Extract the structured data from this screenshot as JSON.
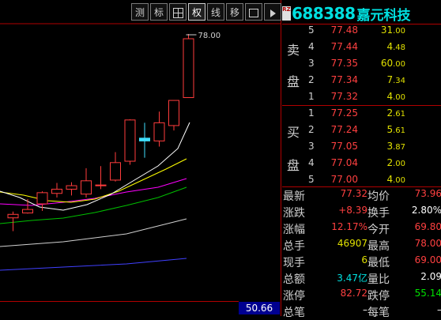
{
  "toolbar": {
    "buttons": [
      {
        "label": "测",
        "icon": null
      },
      {
        "label": "标",
        "icon": null
      },
      {
        "label": "",
        "icon": "grid-icon"
      },
      {
        "label": "权",
        "icon": null
      },
      {
        "label": "线",
        "icon": null
      },
      {
        "label": "移",
        "icon": null
      },
      {
        "label": "",
        "icon": "window-icon"
      },
      {
        "label": "",
        "icon": "play-icon"
      }
    ]
  },
  "stock": {
    "badge": "RZ",
    "code": "688388",
    "name": "嘉元科技"
  },
  "chart": {
    "high_label": "78.00",
    "price_readout": "50.66",
    "candles": [
      {
        "o": 52.2,
        "h": 52.6,
        "l": 49.8,
        "c": 51.7
      },
      {
        "o": 52.9,
        "h": 54.4,
        "l": 52.3,
        "c": 52.4
      },
      {
        "o": 53.7,
        "h": 55.5,
        "l": 52.7,
        "c": 55.3
      },
      {
        "o": 55.8,
        "h": 56.7,
        "l": 54.6,
        "c": 55.2
      },
      {
        "o": 56.3,
        "h": 56.8,
        "l": 54.9,
        "c": 55.8
      },
      {
        "o": 55.1,
        "h": 58.8,
        "l": 54.6,
        "c": 57.0
      },
      {
        "o": 56.3,
        "h": 59.1,
        "l": 55.8,
        "c": 56.4
      },
      {
        "o": 57.1,
        "h": 61.1,
        "l": 56.9,
        "c": 59.6
      },
      {
        "o": 59.8,
        "h": 65.8,
        "l": 59.3,
        "c": 65.7
      },
      {
        "o": 63.1,
        "h": 65.3,
        "l": 60.3,
        "c": 62.7
      },
      {
        "o": 62.7,
        "h": 66.9,
        "l": 61.9,
        "c": 65.3
      },
      {
        "o": 64.9,
        "h": 68.5,
        "l": 64.2,
        "c": 68.5
      },
      {
        "o": 68.9,
        "h": 78.0,
        "l": 68.9,
        "c": 77.32
      }
    ],
    "colors": {
      "up": "#ff3c3c",
      "down": "#40e0ff",
      "ma5": "#ffffff",
      "ma10": "#ffff00",
      "ma20": "#ff00ff",
      "ma60": "#00c000",
      "ma120": "#d0d0d0",
      "ma250": "#4040ff"
    }
  },
  "order_book": {
    "sell_label_1": "卖",
    "sell_label_2": "盘",
    "buy_label_1": "买",
    "buy_label_2": "盘",
    "asks": [
      {
        "level": "5",
        "price": "77.48",
        "vol_int": "31",
        "vol_dec": ".00"
      },
      {
        "level": "4",
        "price": "77.44",
        "vol_int": "4",
        "vol_dec": ".48"
      },
      {
        "level": "3",
        "price": "77.35",
        "vol_int": "60",
        "vol_dec": ".00"
      },
      {
        "level": "2",
        "price": "77.34",
        "vol_int": "7",
        "vol_dec": ".34"
      },
      {
        "level": "1",
        "price": "77.32",
        "vol_int": "4",
        "vol_dec": ".00"
      }
    ],
    "bids": [
      {
        "level": "1",
        "price": "77.25",
        "vol_int": "2",
        "vol_dec": ".61"
      },
      {
        "level": "2",
        "price": "77.24",
        "vol_int": "5",
        "vol_dec": ".61"
      },
      {
        "level": "3",
        "price": "77.05",
        "vol_int": "3",
        "vol_dec": ".87"
      },
      {
        "level": "4",
        "price": "77.04",
        "vol_int": "2",
        "vol_dec": ".00"
      },
      {
        "level": "5",
        "price": "77.00",
        "vol_int": "4",
        "vol_dec": ".00"
      }
    ]
  },
  "stats": [
    {
      "l1": "最新",
      "v1": "77.32",
      "c1": "red",
      "l2": "均价",
      "v2": "73.96",
      "c2": "red"
    },
    {
      "l1": "涨跌",
      "v1": "+8.39",
      "c1": "red",
      "l2": "换手",
      "v2": "2.80%",
      "c2": "wht"
    },
    {
      "l1": "涨幅",
      "v1": "12.17%",
      "c1": "red",
      "l2": "今开",
      "v2": "69.80",
      "c2": "red"
    },
    {
      "l1": "总手",
      "v1": "46907",
      "c1": "yel",
      "l2": "最高",
      "v2": "78.00",
      "c2": "red"
    },
    {
      "l1": "现手",
      "v1": "6",
      "c1": "yel",
      "l2": "最低",
      "v2": "69.00",
      "c2": "red"
    },
    {
      "l1": "总额",
      "v1": "3.47亿",
      "c1": "cy",
      "l2": "量比",
      "v2": "2.09",
      "c2": "wht"
    },
    {
      "l1": "涨停",
      "v1": "82.72",
      "c1": "red",
      "l2": "跌停",
      "v2": "55.14",
      "c2": "grn"
    },
    {
      "l1": "总笔",
      "v1": "–",
      "c1": "wht",
      "l2": "每笔",
      "v2": "–",
      "c2": "wht"
    }
  ]
}
